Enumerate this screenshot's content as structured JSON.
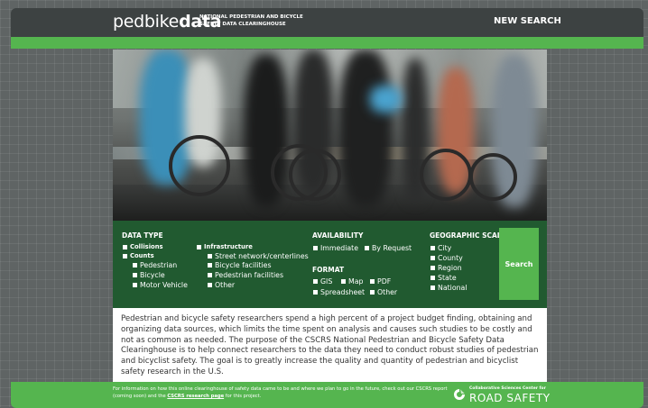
{
  "header": {
    "logo_light": "pedbike",
    "logo_bold": "data",
    "tagline_line1": "NATIONAL PEDESTRIAN AND BICYCLE",
    "tagline_line2": "SAFETY DATA CLEARINGHOUSE",
    "new_search": "NEW SEARCH"
  },
  "filters": {
    "data_type": {
      "title": "DATA TYPE",
      "collisions": "Collisions",
      "counts": "Counts",
      "counts_sub": [
        "Pedestrian",
        "Bicycle",
        "Motor Vehicle"
      ],
      "infrastructure": "Infrastructure",
      "infrastructure_sub": [
        "Street network/centerlines",
        "Bicycle facilities",
        "Pedestrian facilities",
        "Other"
      ]
    },
    "availability": {
      "title": "AVAILABILITY",
      "options": [
        "Immediate",
        "By Request"
      ]
    },
    "format": {
      "title": "FORMAT",
      "row1": [
        "GIS",
        "Map",
        "PDF"
      ],
      "row2": [
        "Spreadsheet",
        "Other"
      ]
    },
    "geographic_scale": {
      "title": "GEOGRAPHIC SCALE",
      "options": [
        "City",
        "County",
        "Region",
        "State",
        "National"
      ]
    },
    "search_label": "Search"
  },
  "description": "Pedestrian and bicycle safety researchers spend a high percent of a project budget finding, obtaining and organizing data sources, which limits the time spent on analysis and causes such studies to be costly and not as common as needed. The purpose of the CSCRS National Pedestrian and Bicycle Safety Data Clearinghouse is to help connect researchers to the data they need to conduct robust studies of pedestrian and bicyclist safety. The goal is to greatly increase the quality and quantity of pedestrian and bicyclist safety research in the U.S.",
  "footer": {
    "note_before": "For information on how this online clearinghouse of safety data came to be and where we plan to go in the future, check out our CSCRS report (coming soon) and the ",
    "link": "CSCRS research page",
    "note_after": " for this project.",
    "cscrs_small": "Collaborative Sciences Center for",
    "cscrs_big": "ROAD SAFETY"
  },
  "colors": {
    "brand_green": "#55b54f",
    "dark_green": "#215a30",
    "header_dark": "#3d4242"
  }
}
